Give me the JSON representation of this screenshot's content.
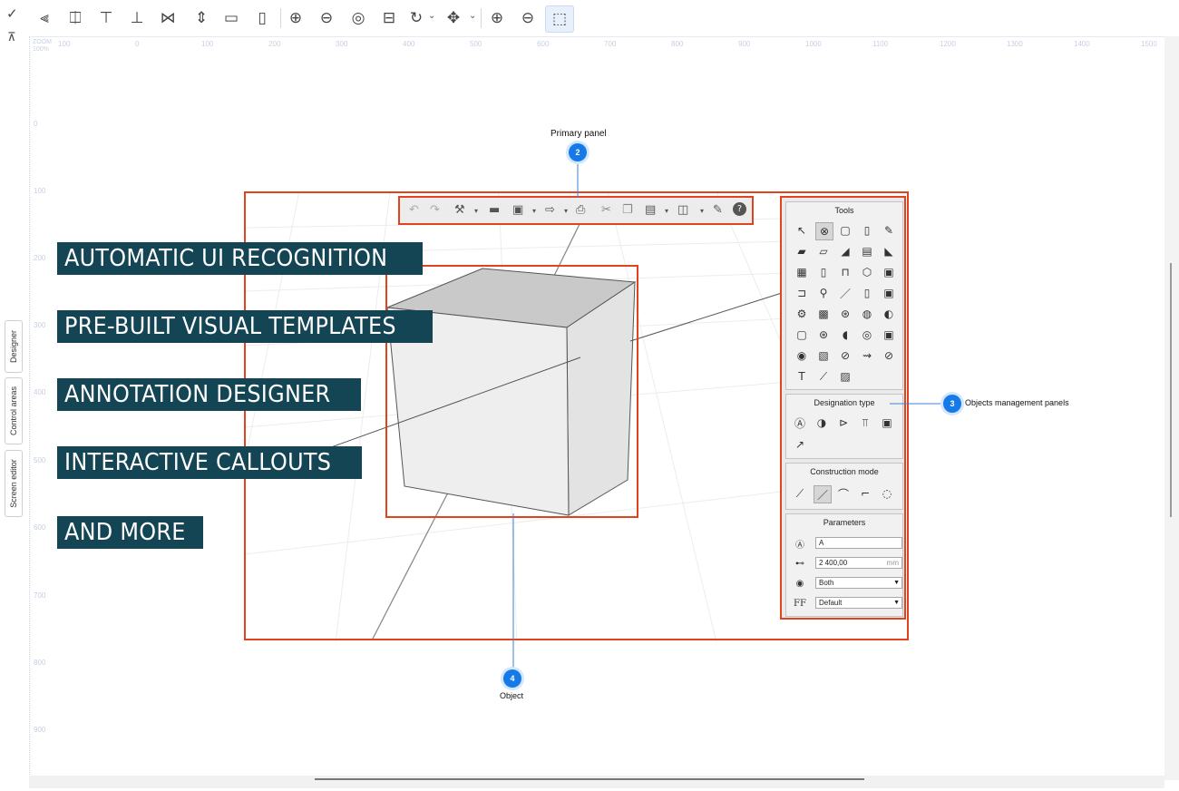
{
  "toolbar": {
    "check_icon": "check-icon",
    "pin_icon": "pin-icon",
    "buttons": [
      "align-left-icon",
      "align-center-icon",
      "align-top-icon",
      "align-bottom-icon",
      "distribute-icon",
      "distribute-vertical-icon",
      "equal-width-icon",
      "equal-height-icon",
      "zoom-in-circle-icon",
      "zoom-out-circle-icon",
      "clear-icon",
      "settings-icon",
      "rotate-icon",
      "move-icon",
      "zoom-in-icon",
      "zoom-out-icon",
      "select-area-icon"
    ]
  },
  "ruler": {
    "zoom_label": "ZOOM",
    "zoom_value": "100%",
    "h_ticks": [
      "100",
      "0",
      "100",
      "200",
      "300",
      "400",
      "500",
      "600",
      "700",
      "800",
      "900",
      "1000",
      "1100",
      "1200",
      "1300",
      "1400",
      "1500"
    ],
    "v_ticks": [
      "0",
      "100",
      "200",
      "300",
      "400",
      "500",
      "600",
      "700",
      "800",
      "900"
    ]
  },
  "side_tabs": [
    "Designer",
    "Control areas",
    "Screen editor"
  ],
  "callouts": [
    {
      "number": "2",
      "label": "Primary panel"
    },
    {
      "number": "3",
      "label": "Objects management panels"
    },
    {
      "number": "4",
      "label": "Object"
    }
  ],
  "banners": [
    "AUTOMATIC UI RECOGNITION",
    "PRE-BUILT VISUAL TEMPLATES",
    "ANNOTATION DESIGNER",
    "INTERACTIVE CALLOUTS",
    "AND MORE"
  ],
  "app_panel": {
    "tools_title": "Tools",
    "designation_title": "Designation type",
    "construction_title": "Construction mode",
    "parameters_title": "Parameters",
    "param_name": "A",
    "param_length": "2 400,00",
    "param_unit": "mm",
    "param_visibility": "Both",
    "param_font": "Default",
    "font_icon_label": "FF",
    "text_tool_label": "T"
  },
  "colors": {
    "accent": "#1679e8",
    "highlight_border": "#e2431f",
    "banner_bg": "#134555"
  }
}
